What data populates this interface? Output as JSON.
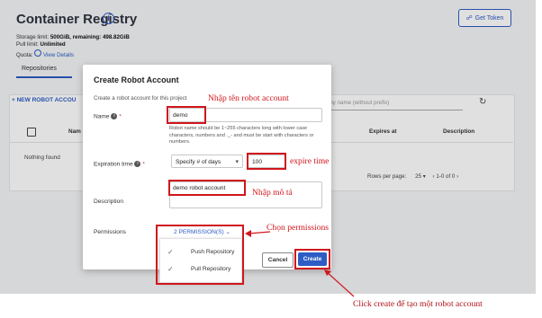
{
  "page": {
    "title": "Container Registry",
    "get_token": "Get Token",
    "storage_label": "Storage limit:",
    "storage_value": "500GiB, remaining: 498.82GiB",
    "pull_label": "Pull limit:",
    "pull_value": "Unlimited",
    "quota_label": "Quota:",
    "view_details": "View Details",
    "tab_repositories": "Repositories",
    "new_robot_button": "+ NEW ROBOT ACCOU",
    "search_placeholder": "rch by name (without prefix)",
    "col_name": "Nam",
    "col_expires": "Expires at",
    "col_description": "Description",
    "nothing_found": "Nothing found",
    "rows_per_page": "Rows per page:",
    "rows_value": "25",
    "range": "1-0 of 0"
  },
  "modal": {
    "title": "Create Robot Account",
    "subtitle": "Create a robot account for this project",
    "name_label": "Name",
    "name_value": "demo",
    "name_hint": "Robot name should be 1~255 characters long with lower case characters, numbers and ._- and must be start with characters or numbers.",
    "expiration_label": "Expiration time",
    "expiration_select": "Specify # of days",
    "expiration_days": "100",
    "description_label": "Description",
    "description_value": "demo robot account",
    "permissions_label": "Permissions",
    "permissions_button": "2 PERMISSION(S)",
    "permissions": [
      "Push Repository",
      "Pull Repository"
    ],
    "cancel": "Cancel",
    "create": "Create"
  },
  "annotations": {
    "name": "Nhập tên robot account",
    "expire": "expire time",
    "description": "Nhập mô tả",
    "permissions": "Chọn permissions",
    "create": "Click create để tạo một robot account"
  },
  "colors": {
    "accent": "#2d5cc4",
    "annotation": "#d0161c"
  },
  "icons": {
    "info": "info-icon",
    "token": "key-icon",
    "refresh": "refresh-icon",
    "check": "check-icon",
    "dropdown": "chevron-down-icon"
  }
}
